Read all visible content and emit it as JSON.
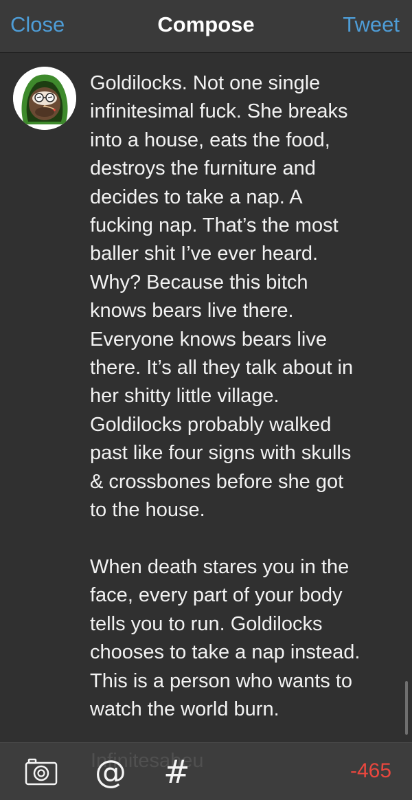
{
  "nav": {
    "close_label": "Close",
    "title": "Compose",
    "tweet_label": "Tweet"
  },
  "compose": {
    "text": "Goldilocks. Not one single\ninfinitesimal fuck. She breaks\ninto a house, eats the food,\ndestroys the furniture and\ndecides to take a nap. A\nfucking nap. That’s the most\nballer shit I’ve ever heard.\nWhy? Because this bitch\nknows bears live there.\nEveryone knows bears live\nthere. It’s all they talk about in\nher shitty little village.\nGoldilocks probably walked\npast like four signs with skulls\n& crossbones before she got\nto the house.\n\nWhen death stares you in the\nface, every part of your body\ntells you to run. Goldilocks\nchooses to take a nap instead.\nThis is a person who wants to\nwatch the world burn.",
    "overflow_text": "Infinitesabeu"
  },
  "toolbar": {
    "camera_icon": "camera-icon",
    "mention_symbol": "@",
    "hashtag_symbol": "#",
    "char_count": "-465",
    "char_count_color": "#e9473e"
  },
  "colors": {
    "accent": "#4e9dd7",
    "background": "#303030",
    "nav_background": "#3a3a3a"
  }
}
